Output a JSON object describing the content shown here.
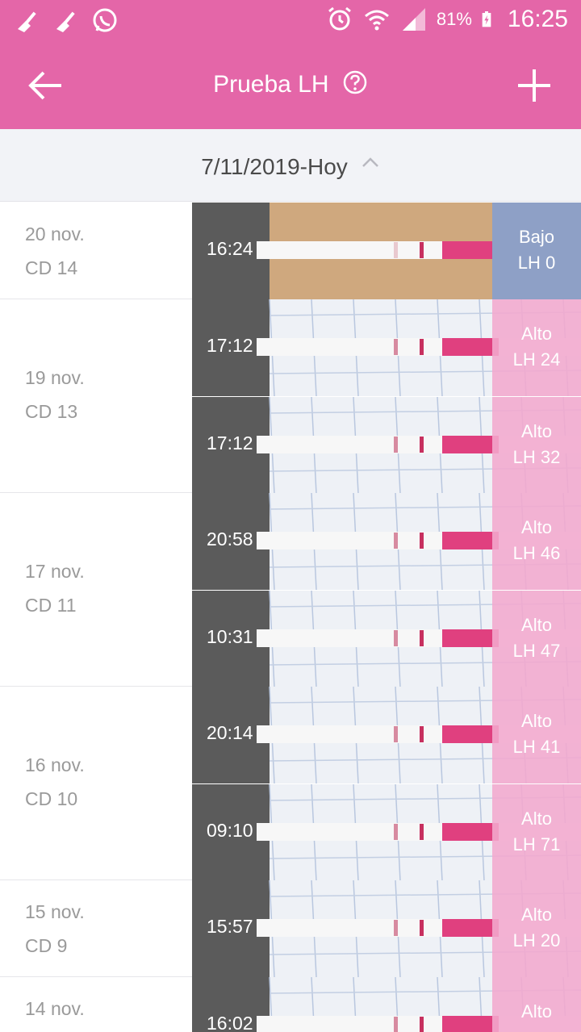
{
  "status_bar": {
    "battery": "81%",
    "time": "16:25",
    "icons": [
      "broom-icon",
      "broom-icon",
      "whatsapp-icon",
      "alarm-icon",
      "wifi-icon",
      "signal-icon",
      "battery-charging-icon"
    ]
  },
  "app_bar": {
    "title": "Prueba LH",
    "back_icon": "arrow-left-icon",
    "help_icon": "question-circle-icon",
    "add_icon": "plus-icon"
  },
  "range": {
    "label": "7/11/2019-Hoy",
    "icon": "chevron-up-icon"
  },
  "colors": {
    "accent": "#e466a8",
    "result_high": "#f2a8ce",
    "result_low": "#8ea0c6",
    "range_bg": "#f2f3f7"
  },
  "groups": [
    {
      "date": "20 nov.",
      "cycle_day": "CD 14",
      "entries": [
        {
          "time": "16:24",
          "level": "Bajo",
          "lh": "LH 0",
          "low": true
        }
      ]
    },
    {
      "date": "19 nov.",
      "cycle_day": "CD 13",
      "entries": [
        {
          "time": "17:12",
          "level": "Alto",
          "lh": "LH 24"
        },
        {
          "time": "17:12",
          "level": "Alto",
          "lh": "LH 32"
        }
      ]
    },
    {
      "date": "17 nov.",
      "cycle_day": "CD 11",
      "entries": [
        {
          "time": "20:58",
          "level": "Alto",
          "lh": "LH 46"
        },
        {
          "time": "10:31",
          "level": "Alto",
          "lh": "LH 47"
        }
      ]
    },
    {
      "date": "16 nov.",
      "cycle_day": "CD 10",
      "entries": [
        {
          "time": "20:14",
          "level": "Alto",
          "lh": "LH 41"
        },
        {
          "time": "09:10",
          "level": "Alto",
          "lh": "LH 71"
        }
      ]
    },
    {
      "date": "15 nov.",
      "cycle_day": "CD 9",
      "entries": [
        {
          "time": "15:57",
          "level": "Alto",
          "lh": "LH 20"
        }
      ]
    },
    {
      "date": "14 nov.",
      "cycle_day": "",
      "entries": [
        {
          "time": "16:02",
          "level": "Alto",
          "lh": ""
        }
      ]
    }
  ]
}
